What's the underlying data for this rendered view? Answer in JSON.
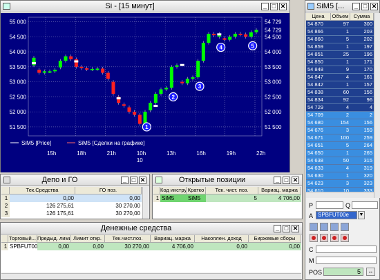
{
  "chart_window": {
    "title": "Si - [15 минут]"
  },
  "chart_data": {
    "type": "candlestick",
    "title": "",
    "y_ticks": [
      "55 000",
      "54 500",
      "54 000",
      "53 500",
      "53 000",
      "52 500",
      "52 000",
      "51 500"
    ],
    "y_ticks_right": [
      "54 729",
      "54 500",
      "54 000",
      "53 500",
      "53 000",
      "52 500",
      "52 000",
      "51 500"
    ],
    "ylim": [
      51200,
      55150
    ],
    "x_ticks": [
      "15h",
      "18h",
      "21h",
      "10h",
      "13h",
      "16h",
      "19h",
      "22h"
    ],
    "x_sub_tick": "10",
    "legend": [
      "SiM5 [Price]",
      "SiM5 [Сделки на графике]"
    ],
    "price_label": "54 729",
    "candles": [
      {
        "t": 0,
        "o": 53550,
        "c": 53800
      },
      {
        "t": 1,
        "o": 53400,
        "c": 53300
      },
      {
        "t": 2,
        "o": 53300,
        "c": 53350
      },
      {
        "t": 3,
        "o": 53350,
        "c": 53350
      },
      {
        "t": 4,
        "o": 53350,
        "c": 53400
      },
      {
        "t": 5,
        "o": 53480,
        "c": 53700
      },
      {
        "t": 6,
        "o": 53700,
        "c": 53850
      },
      {
        "t": 7,
        "o": 53850,
        "c": 53750
      },
      {
        "t": 8,
        "o": 53750,
        "c": 53500
      },
      {
        "t": 9,
        "o": 53500,
        "c": 53450
      },
      {
        "t": 10,
        "o": 53450,
        "c": 53420
      },
      {
        "t": 11,
        "o": 53420,
        "c": 53430
      },
      {
        "t": 12,
        "o": 53430,
        "c": 53440
      },
      {
        "t": 13,
        "o": 53440,
        "c": 53300
      },
      {
        "t": 14,
        "o": 53300,
        "c": 53100
      },
      {
        "t": 15,
        "o": 53000,
        "c": 52600
      },
      {
        "t": 16,
        "o": 52500,
        "c": 52300
      },
      {
        "t": 17,
        "o": 52250,
        "c": 52200
      },
      {
        "t": 18,
        "o": 52150,
        "c": 52000
      },
      {
        "t": 19,
        "o": 52000,
        "c": 51900
      },
      {
        "t": 20,
        "o": 51900,
        "c": 51600
      },
      {
        "t": 21,
        "o": 51600,
        "c": 52000
      },
      {
        "t": 22,
        "o": 52050,
        "c": 52300
      },
      {
        "t": 23,
        "o": 52300,
        "c": 52600
      },
      {
        "t": 24,
        "o": 52600,
        "c": 52750
      },
      {
        "t": 25,
        "o": 52750,
        "c": 52800
      },
      {
        "t": 26,
        "o": 52800,
        "c": 53500
      },
      {
        "t": 27,
        "o": 53500,
        "c": 53550
      },
      {
        "t": 28,
        "o": 53000,
        "c": 52950
      },
      {
        "t": 29,
        "o": 52950,
        "c": 53100
      },
      {
        "t": 30,
        "o": 53100,
        "c": 53150
      },
      {
        "t": 31,
        "o": 53150,
        "c": 53700
      },
      {
        "t": 32,
        "o": 53700,
        "c": 54300
      },
      {
        "t": 33,
        "o": 54300,
        "c": 54600
      },
      {
        "t": 34,
        "o": 54600,
        "c": 54550
      },
      {
        "t": 35,
        "o": 54500,
        "c": 54600
      },
      {
        "t": 36,
        "o": 54450,
        "c": 54400
      },
      {
        "t": 37,
        "o": 54400,
        "c": 54500
      },
      {
        "t": 38,
        "o": 54500,
        "c": 54600
      },
      {
        "t": 39,
        "o": 54600,
        "c": 54580
      },
      {
        "t": 40,
        "o": 54580,
        "c": 54500
      },
      {
        "t": 41,
        "o": 54500,
        "c": 54650
      },
      {
        "t": 42,
        "o": 54650,
        "c": 54729
      }
    ],
    "trades": [
      {
        "t": 0,
        "y": 53620
      },
      {
        "t": 8,
        "y": 53680
      },
      {
        "t": 16,
        "y": 52450
      },
      {
        "t": 23,
        "y": 52200
      },
      {
        "t": 28,
        "y": 53560
      },
      {
        "t": 35,
        "y": 54580
      }
    ],
    "markers": [
      {
        "label": "1",
        "t": 20,
        "y": 51500
      },
      {
        "label": "2",
        "t": 25,
        "y": 52500
      },
      {
        "label": "3",
        "t": 30,
        "y": 52850
      },
      {
        "label": "4",
        "t": 34,
        "y": 54150
      },
      {
        "label": "5",
        "t": 40,
        "y": 54200
      }
    ]
  },
  "depo": {
    "title": "Депо и ГО",
    "columns": [
      "",
      "Тек.Средства",
      "ГО поз."
    ],
    "rows": [
      [
        "1",
        "0,00",
        "0,00"
      ],
      [
        "2",
        "126 275,61",
        "30 270,00"
      ],
      [
        "3",
        "126 175,61",
        "30 270,00"
      ]
    ]
  },
  "positions": {
    "title": "Открытые позиции",
    "columns": [
      "",
      "Код инструм.",
      "Кратко",
      "Тек. чист. поз.",
      "Вариац. маржа"
    ],
    "rows": [
      [
        "1",
        "SiM5",
        "SiM5",
        "5",
        "4 706,00"
      ]
    ]
  },
  "money": {
    "title": "Денежные средства",
    "columns": [
      "",
      "Торговый...",
      "Предыд. лими...",
      "Лимит откр.",
      "Тек.чист.поз.",
      "Вариац. маржа",
      "Накоплен. доход",
      "Биржевые сборы"
    ],
    "rows": [
      [
        "1",
        "SPBFUT00",
        "0,00",
        "0,00",
        "30 270,00",
        "4 706,00",
        "0,00",
        "0,00"
      ]
    ]
  },
  "dom": {
    "title": "SiM5 [...",
    "columns": [
      "Цена",
      "Объем",
      "Сумма"
    ],
    "asks": [
      [
        "54 870",
        "97",
        "300"
      ],
      [
        "54 866",
        "1",
        "203"
      ],
      [
        "54 860",
        "5",
        "202"
      ],
      [
        "54 859",
        "1",
        "197"
      ],
      [
        "54 851",
        "25",
        "196"
      ],
      [
        "54 850",
        "1",
        "171"
      ],
      [
        "54 848",
        "9",
        "170"
      ],
      [
        "54 847",
        "4",
        "161"
      ],
      [
        "54 842",
        "1",
        "157"
      ],
      [
        "54 838",
        "60",
        "156"
      ],
      [
        "54 834",
        "92",
        "96"
      ],
      [
        "54 729",
        "4",
        "4"
      ]
    ],
    "bids": [
      [
        "54 709",
        "2",
        "2"
      ],
      [
        "54 680",
        "154",
        "156"
      ],
      [
        "54 676",
        "3",
        "159"
      ],
      [
        "54 671",
        "100",
        "259"
      ],
      [
        "54 651",
        "5",
        "264"
      ],
      [
        "54 650",
        "1",
        "265"
      ],
      [
        "54 638",
        "50",
        "315"
      ],
      [
        "54 633",
        "4",
        "319"
      ],
      [
        "54 630",
        "1",
        "320"
      ],
      [
        "54 623",
        "3",
        "323"
      ],
      [
        "54 610",
        "10",
        "333"
      ]
    ],
    "p_label": "P",
    "q_label": "Q",
    "a_label": "A",
    "account": "SPBFUT00e",
    "c_label": "C",
    "m_label": "M",
    "pos_label": "POS",
    "pos_value": "5"
  },
  "colors": {
    "chart_bg": "#000080",
    "bull": "#00ff00",
    "bear": "#ff2020",
    "marker_bg": "#1a1aff",
    "grid": "#9999cc"
  }
}
